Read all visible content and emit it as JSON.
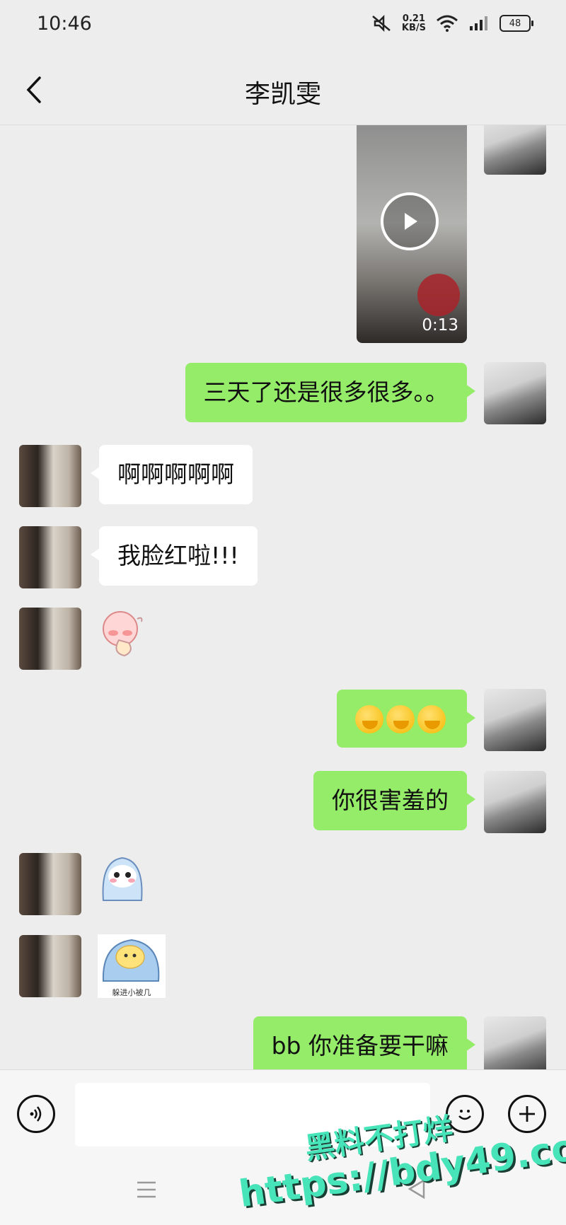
{
  "status_bar": {
    "time": "10:46",
    "net_speed_value": "0.21",
    "net_speed_unit": "KB/S",
    "battery": "48"
  },
  "header": {
    "title": "李凯雯"
  },
  "messages": {
    "video_duration": "0:13",
    "m1": "三天了还是很多很多。。",
    "m2": "啊啊啊啊啊",
    "m3": "我脸红啦!!!",
    "m5": "你很害羞的",
    "sticker_caption": "躲进小被几",
    "m6": "bb 你准备要干嘛"
  },
  "watermark": {
    "line1": "黑料不打烊",
    "line2": "https://bdy49.co"
  },
  "colors": {
    "sent_bubble": "#95ec69",
    "received_bubble": "#ffffff",
    "background": "#ededed"
  }
}
